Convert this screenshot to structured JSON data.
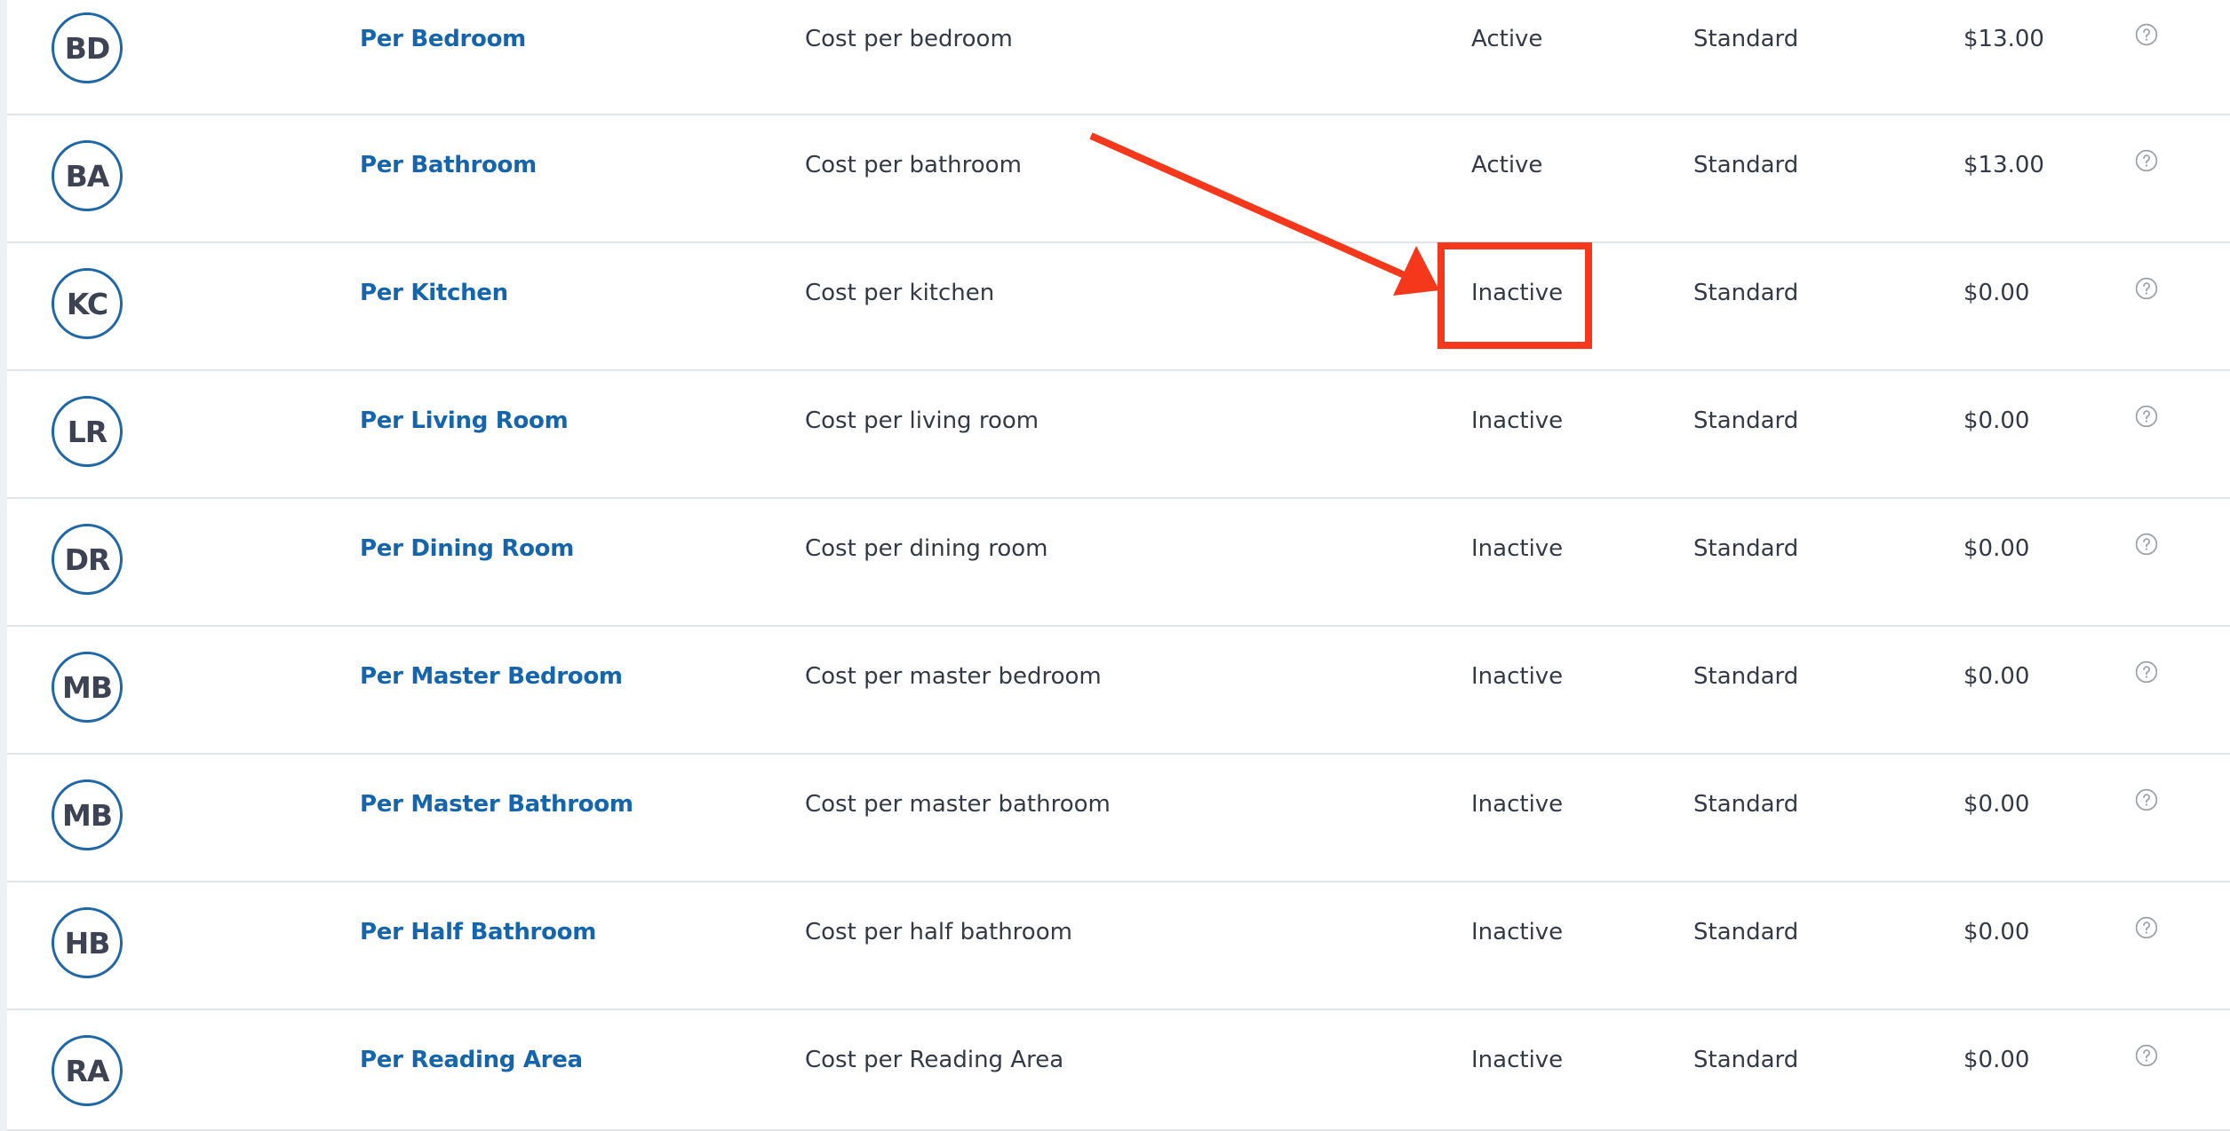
{
  "rows": [
    {
      "initials": "BD",
      "name": "Per Bedroom",
      "description": "Cost per bedroom",
      "status": "Active",
      "type": "Standard",
      "price": "$13.00"
    },
    {
      "initials": "BA",
      "name": "Per Bathroom",
      "description": "Cost per bathroom",
      "status": "Active",
      "type": "Standard",
      "price": "$13.00"
    },
    {
      "initials": "KC",
      "name": "Per Kitchen",
      "description": "Cost per kitchen",
      "status": "Inactive",
      "type": "Standard",
      "price": "$0.00"
    },
    {
      "initials": "LR",
      "name": "Per Living Room",
      "description": "Cost per living room",
      "status": "Inactive",
      "type": "Standard",
      "price": "$0.00"
    },
    {
      "initials": "DR",
      "name": "Per Dining Room",
      "description": "Cost per dining room",
      "status": "Inactive",
      "type": "Standard",
      "price": "$0.00"
    },
    {
      "initials": "MB",
      "name": "Per Master Bedroom",
      "description": "Cost per master bedroom",
      "status": "Inactive",
      "type": "Standard",
      "price": "$0.00"
    },
    {
      "initials": "MB",
      "name": "Per Master Bathroom",
      "description": "Cost per master bathroom",
      "status": "Inactive",
      "type": "Standard",
      "price": "$0.00"
    },
    {
      "initials": "HB",
      "name": "Per Half Bathroom",
      "description": "Cost per half bathroom",
      "status": "Inactive",
      "type": "Standard",
      "price": "$0.00"
    },
    {
      "initials": "RA",
      "name": "Per Reading Area",
      "description": "Cost per Reading Area",
      "status": "Inactive",
      "type": "Standard",
      "price": "$0.00"
    }
  ],
  "colors": {
    "link": "#1565ae",
    "avatar_border": "#1f67a6",
    "annotation": "#f5371b",
    "divider": "#e2e5e8"
  },
  "icons": {
    "row_action": "question-circle-icon",
    "annotation_arrow": "red-arrow-icon",
    "annotation_box": "highlight-box"
  }
}
